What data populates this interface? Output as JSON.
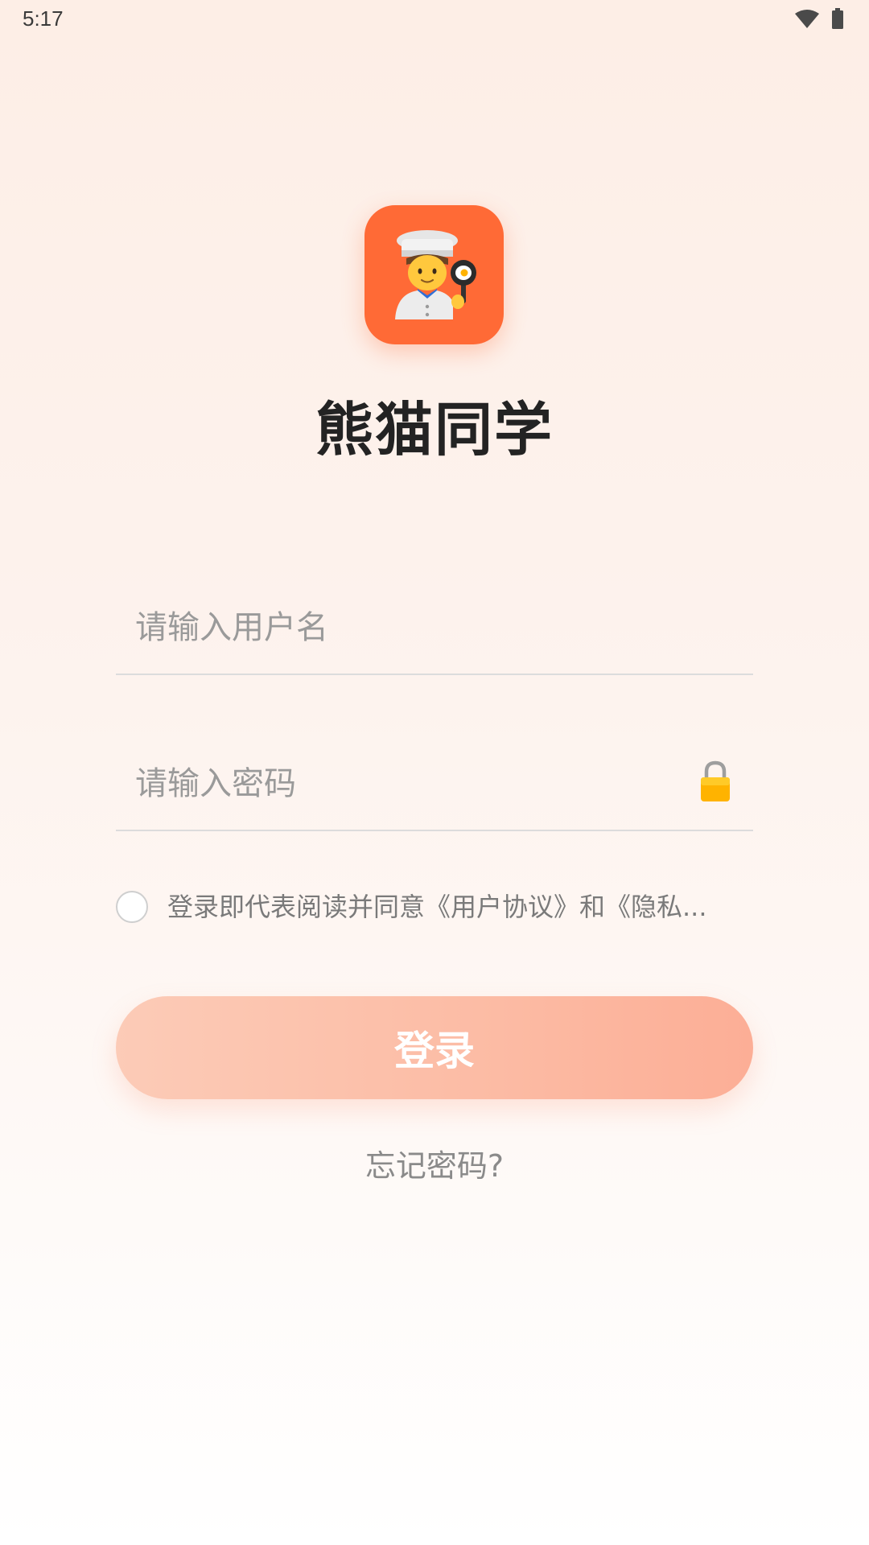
{
  "status_bar": {
    "time": "5:17"
  },
  "app": {
    "icon": "chef-cooking-icon",
    "name": "熊猫同学"
  },
  "form": {
    "username_placeholder": "请输入用户名",
    "username_value": "",
    "password_placeholder": "请输入密码",
    "password_value": "",
    "password_icon": "lock-icon",
    "agreement_checked": false,
    "agreement_text": "登录即代表阅读并同意《用户协议》和《隐私..."
  },
  "actions": {
    "login_label": "登录",
    "forgot_label": "忘记密码?"
  },
  "colors": {
    "accent": "#ff6a36",
    "button_start": "#fccbb7",
    "button_end": "#fcae96"
  }
}
